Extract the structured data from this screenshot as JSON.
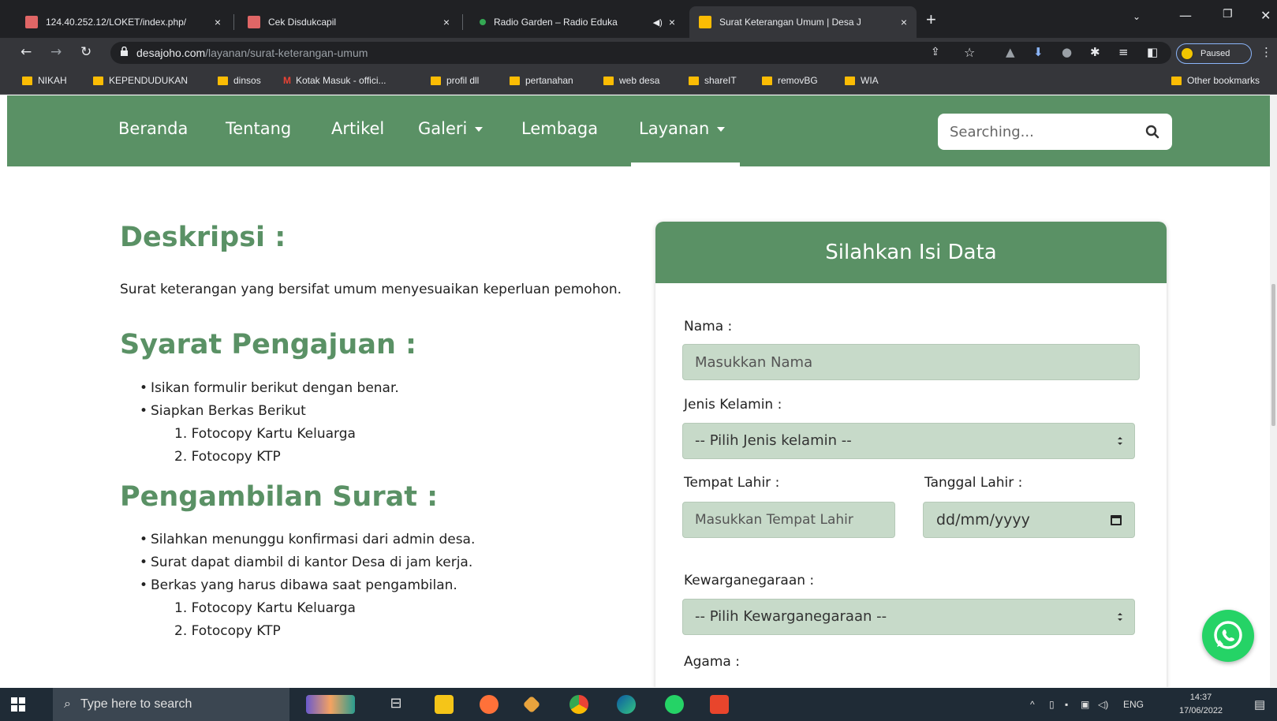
{
  "browser": {
    "tabs": [
      {
        "title": "124.40.252.12/LOKET/index.php/",
        "close": "×",
        "favicon_color": "#e06666"
      },
      {
        "title": "Cek Disdukcapil",
        "close": "×",
        "favicon_color": "#e06666"
      },
      {
        "title": "Radio Garden – Radio Eduka",
        "close": "×",
        "favicon_color": "#34a853"
      },
      {
        "title": "Surat Keterangan Umum | Desa J",
        "close": "×",
        "favicon_color": "#fbbc04"
      }
    ],
    "new_tab": "+",
    "url_host": "desajoho.com",
    "url_path": "/layanan/surat-keterangan-umum",
    "profile_status": "Paused",
    "bookmarks": [
      "NIKAH",
      "KEPENDUDUKAN",
      "dinsos",
      "Kotak Masuk - offici...",
      "profil dll",
      "pertanahan",
      "web desa",
      "shareIT",
      "removBG",
      "WIA"
    ],
    "other_bookmarks": "Other bookmarks",
    "gmail_mark": "M"
  },
  "site": {
    "nav": [
      "Beranda",
      "Tentang",
      "Artikel",
      "Galeri",
      "Lembaga",
      "Layanan"
    ],
    "search_placeholder": "Searching..."
  },
  "content": {
    "deskripsi_title": "Deskripsi :",
    "deskripsi_text": "Surat keterangan yang bersifat umum menyesuaikan keperluan pemohon.",
    "syarat_title": "Syarat Pengajuan :",
    "syarat_items": [
      "Isikan formulir berikut dengan benar.",
      "Siapkan Berkas Berikut"
    ],
    "syarat_sub": [
      "1. Fotocopy Kartu Keluarga",
      "2. Fotocopy KTP"
    ],
    "pengambilan_title": "Pengambilan Surat :",
    "pengambilan_items": [
      "Silahkan menunggu konfirmasi dari admin desa.",
      "Surat dapat diambil di kantor Desa di jam kerja.",
      "Berkas yang harus dibawa saat pengambilan."
    ],
    "pengambilan_sub": [
      "1. Fotocopy Kartu Keluarga",
      "2. Fotocopy KTP"
    ]
  },
  "form": {
    "title": "Silahkan Isi Data",
    "nama_label": "Nama :",
    "nama_placeholder": "Masukkan Nama",
    "jk_label": "Jenis Kelamin :",
    "jk_value": "-- Pilih Jenis kelamin --",
    "tempat_label": "Tempat Lahir :",
    "tempat_placeholder": "Masukkan Tempat Lahir",
    "tanggal_label": "Tanggal Lahir :",
    "tanggal_value": "dd/mm/yyyy",
    "warga_label": "Kewarganegaraan :",
    "warga_value": "-- Pilih Kewarganegaraan --",
    "agama_label": "Agama :"
  },
  "taskbar": {
    "search_placeholder": "Type here to search",
    "lang": "ENG",
    "time": "14:37",
    "date": "17/06/2022"
  },
  "colors": {
    "brand": "#5a9165",
    "input_bg": "#c7dac9",
    "whatsapp": "#25d366"
  }
}
